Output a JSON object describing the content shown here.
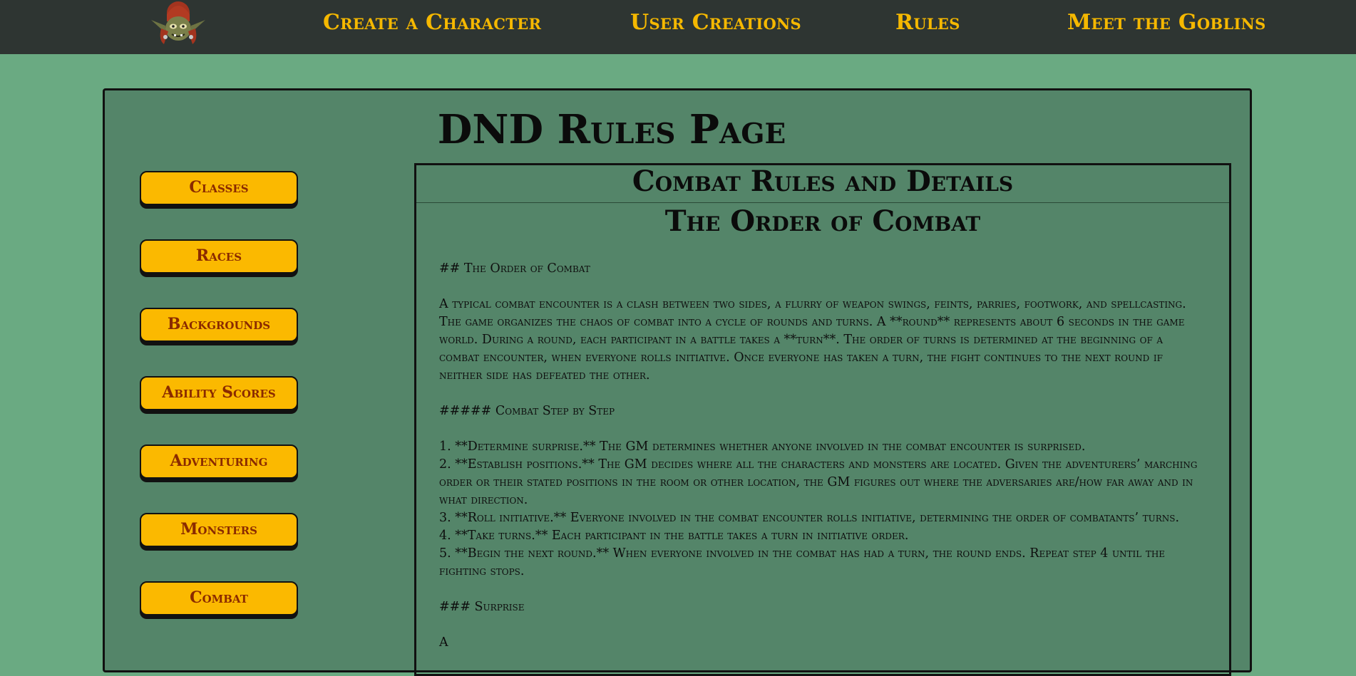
{
  "nav": {
    "logo_alt": "goblin-logo",
    "links": [
      "Create a Character",
      "User Creations",
      "Rules",
      "Meet the Goblins"
    ]
  },
  "page_title": "DND Rules Page",
  "sidebar": {
    "buttons": [
      "Classes",
      "Races",
      "Backgrounds",
      "Ability Scores",
      "Adventuring",
      "Monsters",
      "Combat"
    ]
  },
  "content": {
    "header": "Combat Rules and Details",
    "subheader": "The Order of Combat",
    "md_heading": "## The Order of Combat",
    "intro": "A typical combat encounter is a clash between two sides, a flurry of weapon swings, feints, parries, footwork, and spellcasting. The game organizes the chaos of combat into a cycle of rounds and turns. A **round** represents about 6 seconds in the game world. During a round, each participant in a battle takes a **turn**. The order of turns is determined at the beginning of a combat encounter, when everyone rolls initiative. Once everyone has taken a turn, the fight continues to the next round if neither side has defeated the other.",
    "steps_heading": "##### Combat Step by Step",
    "steps": [
      "1. **Determine surprise.** The GM determines whether anyone involved in the combat encounter is surprised.",
      "2. **Establish positions.** The GM decides where all the characters and monsters are located. Given the adventurers’ marching order or their stated positions in the room or other location, the GM figures out where the adversaries are/how far away and in what direction.",
      "3. **Roll initiative.** Everyone involved in the combat encounter rolls initiative, determining the order of combatants’ turns.",
      "4. **Take turns.** Each participant in the battle takes a turn in initiative order.",
      "5. **Begin the next round.** When everyone involved in the combat has had a turn, the round ends. Repeat step 4 until the fighting stops."
    ],
    "surprise_heading": "### Surprise",
    "surprise_text": "A"
  },
  "colors": {
    "nav_bg": "#2e3532",
    "nav_link": "#f5b800",
    "page_bg": "#6aaa82",
    "panel_bg": "#548569",
    "button_bg": "#fbb900",
    "button_text": "#8a2a00"
  }
}
